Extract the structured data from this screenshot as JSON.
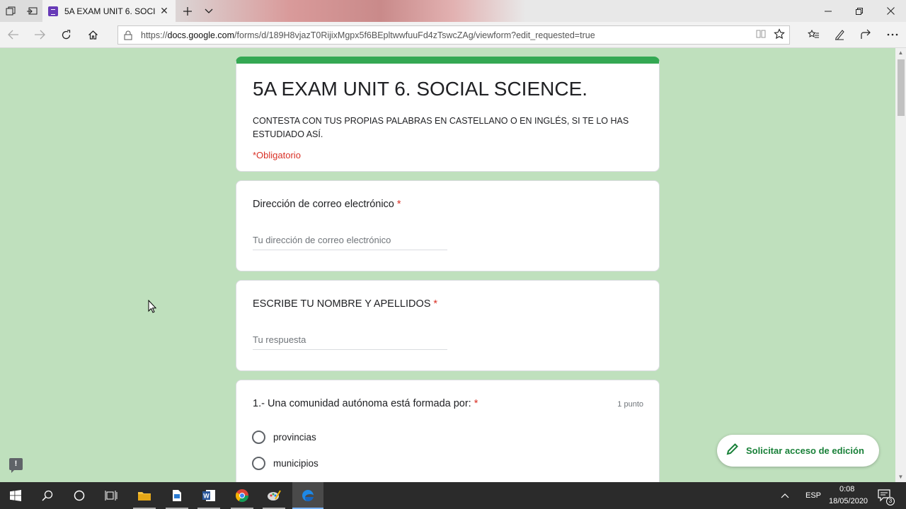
{
  "browser": {
    "tab_title": "5A EXAM UNIT 6. SOCIAL SCIENCE.",
    "url_prefix": "https://",
    "url_domain": "docs.google.com",
    "url_path": "/forms/d/189H8vjazT0RijixMgpx5f6BEpltwwfuuFd4zTswcZAg/viewform?edit_requested=true"
  },
  "form": {
    "title": "5A EXAM UNIT 6. SOCIAL SCIENCE.",
    "description": "CONTESTA CON TUS PROPIAS PALABRAS EN CASTELLANO O EN INGLÉS, SI TE LO HAS ESTUDIADO ASÍ.",
    "required_note": "*Obligatorio"
  },
  "questions": [
    {
      "label": "Dirección de correo electrónico",
      "required_mark": "*",
      "placeholder": "Tu dirección de correo electrónico"
    },
    {
      "label": "ESCRIBE TU NOMBRE Y APELLIDOS",
      "required_mark": "*",
      "placeholder": "Tu respuesta"
    },
    {
      "label": "1.- Una comunidad autónoma está formada por:",
      "required_mark": "*",
      "points": "1 punto",
      "options": [
        "provincias",
        "municipios"
      ]
    }
  ],
  "edit_access_button": "Solicitar acceso de edición",
  "feedback_icon": "!",
  "taskbar": {
    "language": "ESP",
    "time": "0:08",
    "date": "18/05/2020",
    "notifications": "3"
  },
  "colors": {
    "accent_green": "#34a853",
    "page_bg": "#bfe0bd",
    "required_red": "#d93025",
    "button_text": "#188038"
  },
  "icons": [
    "tab-manager-icon",
    "set-aside-icon",
    "forms-favicon-icon",
    "close-tab-icon",
    "new-tab-icon",
    "tab-dropdown-icon",
    "minimize-icon",
    "restore-icon",
    "close-window-icon",
    "back-icon",
    "forward-icon",
    "refresh-icon",
    "home-icon",
    "lock-icon",
    "reading-view-icon",
    "favorite-star-icon",
    "favorites-icon",
    "notes-icon",
    "share-icon",
    "more-icon",
    "pencil-icon",
    "windows-start-icon",
    "search-icon",
    "cortana-icon",
    "task-view-icon",
    "file-explorer-icon",
    "document-icon",
    "word-icon",
    "chrome-icon",
    "paint-icon",
    "edge-icon",
    "chevron-up-icon",
    "notification-icon"
  ]
}
